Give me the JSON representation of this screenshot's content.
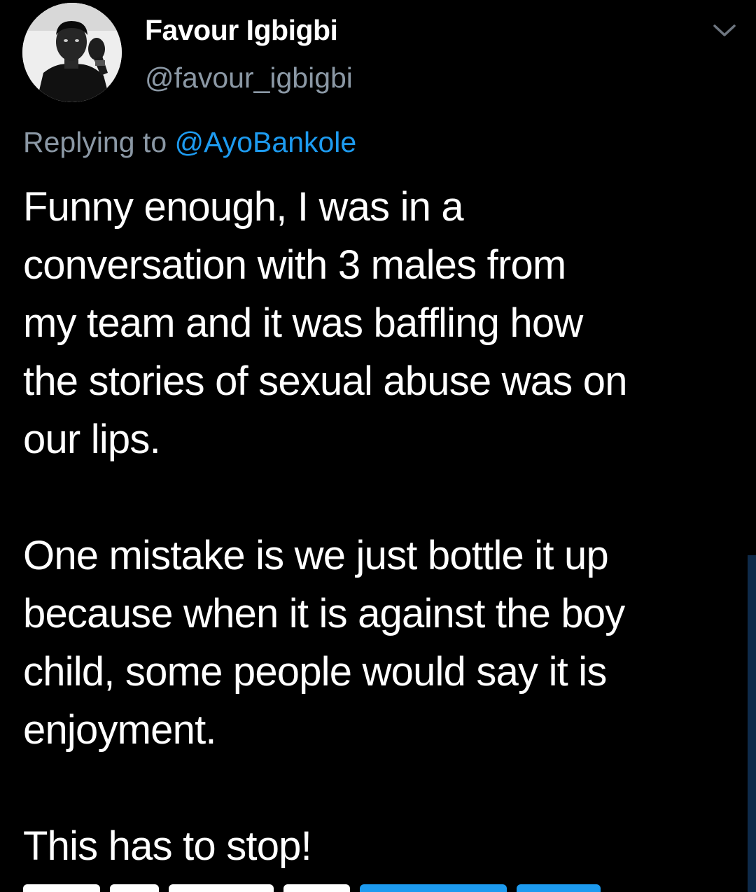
{
  "tweet": {
    "author": {
      "name": "Favour Igbigbi",
      "handle": "@favour_igbigbi",
      "avatar": "profile-photo"
    },
    "menu_icon": "chevron-down-icon",
    "reply": {
      "prefix": "Replying to ",
      "mention": "@AyoBankole"
    },
    "body": "Funny enough, I was in a\nconversation with 3 males from\nmy team and it was baffling how\nthe stories of sexual abuse was on\nour lips.\n\nOne mistake is we just bottle it up\nbecause when it is against the boy\nchild, some people would say it is\nenjoyment.\n\nThis has to stop!"
  },
  "colors": {
    "background": "#000000",
    "text": "#ffffff",
    "secondary_text": "#8b98a5",
    "link": "#1d9bf0"
  }
}
